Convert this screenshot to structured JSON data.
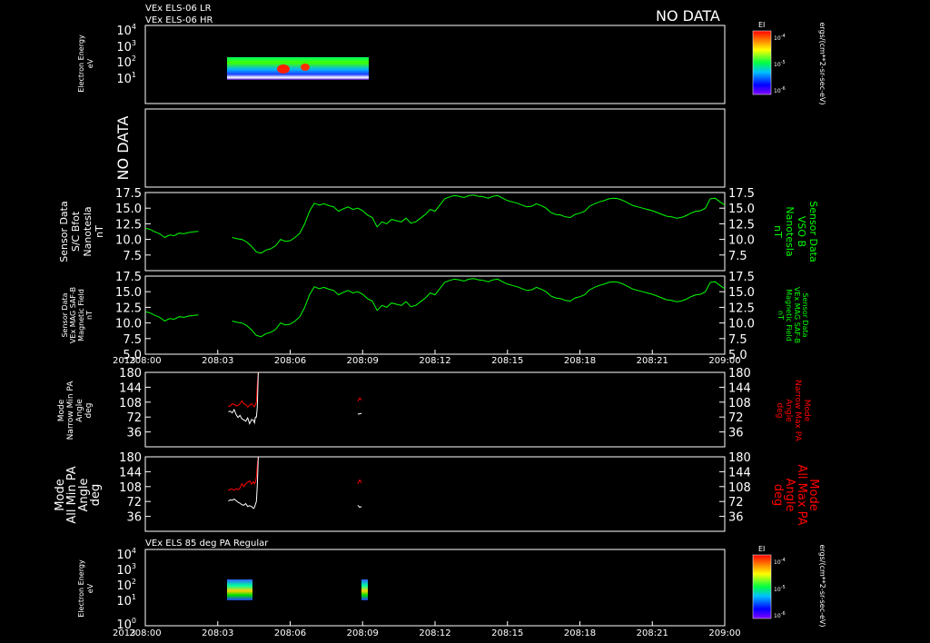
{
  "header": {
    "line1": "VEx ELS-06 LR",
    "line2": "VEx ELS-06 HR",
    "no_data": "NO DATA"
  },
  "colors": {
    "background": "#000000",
    "frame": "#ffffff",
    "mag": "#00ff00",
    "max_pa": "#ff0000",
    "min_pa": "#ffffff"
  },
  "chart_data": [
    {
      "type": "heatmap",
      "title": "",
      "ylabel": [
        "Electron Energy",
        "eV"
      ],
      "y_scale": "log",
      "ylim": [
        1,
        30000
      ],
      "y_ticks": [
        "10^4",
        "10^3",
        "10^2",
        "10^1"
      ],
      "colorbar": {
        "label": "EI",
        "units": "ergs/(cm**2-sr-sec-eV)",
        "ticks": [
          "10^-4",
          "10^-5",
          "10^-6"
        ]
      },
      "xlim": [
        "208:00",
        "209:00"
      ],
      "coverage": [
        {
          "start_min": 3.5,
          "end_min": 9.2,
          "energy_range_eV": [
            5,
            200
          ]
        }
      ]
    },
    {
      "type": "line",
      "label": "NO DATA",
      "series": []
    },
    {
      "type": "line",
      "ylabel_left": [
        "Sensor Data",
        "S/C Bfot",
        "Nanotesla",
        "nT"
      ],
      "ylabel_right": [
        "Sensor Data",
        "VSO B",
        "Nanotesla",
        "nT"
      ],
      "ylim": [
        5,
        17.5
      ],
      "y_ticks": [
        "17.5",
        "15.0",
        "12.5",
        "10.0",
        "7.5"
      ],
      "x": [
        0,
        0.5,
        1,
        1.5,
        2,
        2.5,
        3,
        3.5,
        4,
        4.5,
        5,
        5.5,
        9,
        9.5,
        10,
        10.5,
        11,
        11.5,
        12,
        12.5,
        13,
        13.5,
        14,
        14.5,
        15,
        15.5,
        16,
        16.5,
        17,
        17.5,
        18,
        18.5,
        19,
        19.5,
        20,
        20.5,
        21,
        21.5,
        22,
        22.5,
        23,
        23.5,
        24,
        24.5,
        25,
        25.5,
        26,
        26.5,
        27,
        27.5,
        28,
        28.5,
        29,
        29.5,
        30,
        30.5,
        31,
        31.5,
        32,
        32.5,
        33,
        33.5,
        34,
        34.5,
        35,
        35.5,
        36,
        36.5,
        37,
        37.5,
        38,
        38.5,
        39,
        39.5,
        40,
        40.5,
        41,
        41.5,
        42,
        42.5,
        43,
        43.5,
        44,
        44.5,
        45,
        45.5,
        46,
        46.5,
        47,
        47.5,
        48,
        48.5,
        49,
        49.5,
        50,
        50.5,
        51,
        51.5,
        52,
        52.5,
        53,
        53.5,
        54,
        54.5,
        55,
        55.5,
        56,
        56.5,
        57,
        57.5,
        58,
        58.5,
        59,
        59.5,
        60
      ],
      "y": [
        11.8,
        11.6,
        11.2,
        10.9,
        10.3,
        10.7,
        10.6,
        11.0,
        10.9,
        11.1,
        11.2,
        11.3,
        10.3,
        10.1,
        10.0,
        9.6,
        8.9,
        8.0,
        7.8,
        8.3,
        8.5,
        9.0,
        10.0,
        9.7,
        9.8,
        10.3,
        11.0,
        12.5,
        14.5,
        15.8,
        15.5,
        15.7,
        15.4,
        15.2,
        14.5,
        14.9,
        15.2,
        14.8,
        15.0,
        14.6,
        13.9,
        13.5,
        12.0,
        12.8,
        12.5,
        13.2,
        13.0,
        12.8,
        13.4,
        12.6,
        12.8,
        13.4,
        14.0,
        14.8,
        14.5,
        15.5,
        16.5,
        16.8,
        17.0,
        16.9,
        16.7,
        17.0,
        17.1,
        16.9,
        16.8,
        16.6,
        16.9,
        17.0,
        16.6,
        16.2,
        16.0,
        15.8,
        15.5,
        15.2,
        15.3,
        15.7,
        15.4,
        15.0,
        14.3,
        14.0,
        13.9,
        13.6,
        13.5,
        14.0,
        14.2,
        14.5,
        15.3,
        15.7,
        16.0,
        16.2,
        16.5,
        16.6,
        16.5,
        16.2,
        15.8,
        15.4,
        15.2,
        15.0,
        14.8,
        14.6,
        14.3,
        14.0,
        13.7,
        13.6,
        13.4,
        13.5,
        13.8,
        14.2,
        14.5,
        14.6,
        15.0,
        16.5,
        16.6,
        16.0,
        15.5,
        16.0,
        16.5
      ],
      "gap_after_index": [
        11
      ]
    },
    {
      "type": "line",
      "ylabel_left": [
        "Sensor Data",
        "VEx MAG SAF-B",
        "Magnetic Field",
        "nT"
      ],
      "ylabel_right": [
        "Sensor Data",
        "VEx MAG SAF-B",
        "Magnetic Field",
        "nT"
      ],
      "ylim": [
        5,
        17.5
      ],
      "y_ticks": [
        "17.5",
        "15.0",
        "12.5",
        "10.0",
        "7.5",
        "5.0"
      ],
      "x_ticks": [
        "2013",
        "208:00",
        "208:03",
        "208:06",
        "208:09",
        "208:12",
        "208:15",
        "208:18",
        "208:21",
        "209:00"
      ],
      "x": [
        0,
        0.5,
        1,
        1.5,
        2,
        2.5,
        3,
        3.5,
        4,
        4.5,
        5,
        5.5,
        9,
        9.5,
        10,
        10.5,
        11,
        11.5,
        12,
        12.5,
        13,
        13.5,
        14,
        14.5,
        15,
        15.5,
        16,
        16.5,
        17,
        17.5,
        18,
        18.5,
        19,
        19.5,
        20,
        20.5,
        21,
        21.5,
        22,
        22.5,
        23,
        23.5,
        24,
        24.5,
        25,
        25.5,
        26,
        26.5,
        27,
        27.5,
        28,
        28.5,
        29,
        29.5,
        30,
        30.5,
        31,
        31.5,
        32,
        32.5,
        33,
        33.5,
        34,
        34.5,
        35,
        35.5,
        36,
        36.5,
        37,
        37.5,
        38,
        38.5,
        39,
        39.5,
        40,
        40.5,
        41,
        41.5,
        42,
        42.5,
        43,
        43.5,
        44,
        44.5,
        45,
        45.5,
        46,
        46.5,
        47,
        47.5,
        48,
        48.5,
        49,
        49.5,
        50,
        50.5,
        51,
        51.5,
        52,
        52.5,
        53,
        53.5,
        54,
        54.5,
        55,
        55.5,
        56,
        56.5,
        57,
        57.5,
        58,
        58.5,
        59,
        59.5,
        60
      ],
      "y": [
        11.8,
        11.6,
        11.2,
        10.9,
        10.3,
        10.7,
        10.6,
        11.0,
        10.9,
        11.1,
        11.2,
        11.3,
        10.3,
        10.1,
        10.0,
        9.6,
        8.9,
        8.0,
        7.8,
        8.3,
        8.5,
        9.0,
        10.0,
        9.7,
        9.8,
        10.3,
        11.0,
        12.5,
        14.5,
        15.8,
        15.5,
        15.7,
        15.4,
        15.2,
        14.5,
        14.9,
        15.2,
        14.8,
        15.0,
        14.6,
        13.9,
        13.5,
        12.0,
        12.8,
        12.5,
        13.2,
        13.0,
        12.8,
        13.4,
        12.6,
        12.8,
        13.4,
        14.0,
        14.8,
        14.5,
        15.5,
        16.5,
        16.8,
        17.0,
        16.9,
        16.7,
        17.0,
        17.1,
        16.9,
        16.8,
        16.6,
        16.9,
        17.0,
        16.6,
        16.2,
        16.0,
        15.8,
        15.5,
        15.2,
        15.3,
        15.7,
        15.4,
        15.0,
        14.3,
        14.0,
        13.9,
        13.6,
        13.5,
        14.0,
        14.2,
        14.5,
        15.3,
        15.7,
        16.0,
        16.2,
        16.5,
        16.6,
        16.5,
        16.2,
        15.8,
        15.4,
        15.2,
        15.0,
        14.8,
        14.6,
        14.3,
        14.0,
        13.7,
        13.6,
        13.4,
        13.5,
        13.8,
        14.2,
        14.5,
        14.6,
        15.0,
        16.5,
        16.6,
        16.0,
        15.5,
        16.0,
        16.5
      ],
      "gap_after_index": [
        11
      ]
    },
    {
      "type": "line",
      "ylabel_left": [
        "Mode",
        "Narrow Min PA",
        "Angle",
        "deg"
      ],
      "ylabel_right": [
        "Mode",
        "Narrow Max PA",
        "Angle",
        "deg"
      ],
      "ylim": [
        0,
        180
      ],
      "y_ticks": [
        "180",
        "144",
        "108",
        "72",
        "36"
      ],
      "series": [
        {
          "name": "Max PA",
          "x": [
            8.6,
            8.8,
            9.0,
            9.2,
            9.4,
            9.6,
            9.8,
            10.0,
            10.2,
            10.4,
            10.6,
            10.8,
            11.0,
            11.2,
            11.3,
            11.4,
            11.5,
            11.6,
            11.7,
            22.0,
            22.2,
            22.4
          ],
          "y": [
            97,
            99,
            104,
            103,
            99,
            100,
            104,
            111,
            104,
            102,
            96,
            100,
            104,
            99,
            97,
            102,
            108,
            150,
            180,
            110,
            118,
            113
          ]
        },
        {
          "name": "Min PA",
          "x": [
            8.6,
            8.8,
            9.0,
            9.2,
            9.4,
            9.6,
            9.8,
            10.0,
            10.2,
            10.4,
            10.6,
            10.8,
            11.0,
            11.2,
            11.3,
            11.4,
            11.5,
            11.6,
            11.7,
            22.0,
            22.2,
            22.4
          ],
          "y": [
            85,
            86,
            82,
            90,
            78,
            71,
            76,
            68,
            65,
            62,
            70,
            56,
            66,
            64,
            58,
            72,
            72,
            95,
            180,
            79,
            80,
            81
          ]
        }
      ]
    },
    {
      "type": "line",
      "ylabel_left": [
        "Mode",
        "All Min PA",
        "Angle",
        "deg"
      ],
      "ylabel_right": [
        "Mode",
        "All Max PA",
        "Angle",
        "deg"
      ],
      "ylim": [
        0,
        180
      ],
      "y_ticks": [
        "180",
        "144",
        "108",
        "72",
        "36"
      ],
      "series": [
        {
          "name": "Max PA",
          "x": [
            8.6,
            8.8,
            9.0,
            9.2,
            9.4,
            9.6,
            9.8,
            10.0,
            10.2,
            10.4,
            10.6,
            10.8,
            11.0,
            11.2,
            11.3,
            11.4,
            11.5,
            11.6,
            11.7,
            22.0,
            22.2,
            22.4
          ],
          "y": [
            98,
            102,
            102,
            99,
            103,
            101,
            104,
            115,
            108,
            115,
            118,
            122,
            114,
            120,
            115,
            118,
            130,
            160,
            180,
            115,
            124,
            117
          ]
        },
        {
          "name": "Min PA",
          "x": [
            8.6,
            8.8,
            9.0,
            9.2,
            9.4,
            9.6,
            9.8,
            10.0,
            10.2,
            10.4,
            10.6,
            10.8,
            11.0,
            11.2,
            11.3,
            11.4,
            11.5,
            11.6,
            11.7,
            22.0,
            22.2,
            22.4
          ],
          "y": [
            73,
            76,
            75,
            78,
            74,
            70,
            68,
            64,
            63,
            67,
            60,
            62,
            60,
            55,
            58,
            65,
            72,
            110,
            180,
            63,
            58,
            60
          ]
        }
      ]
    },
    {
      "type": "heatmap",
      "title": "VEx ELS 85 deg PA Regular",
      "ylabel": [
        "Electron Energy",
        "eV"
      ],
      "y_scale": "log",
      "ylim": [
        1,
        30000
      ],
      "y_ticks": [
        "10^4",
        "10^3",
        "10^2",
        "10^1",
        "10^0"
      ],
      "x_ticks": [
        "2013",
        "208:00",
        "208:03",
        "208:06",
        "208:09",
        "208:12",
        "208:15",
        "208:18",
        "208:21",
        "209:00"
      ],
      "colorbar": {
        "label": "EI",
        "units": "ergs/(cm**2-sr-sec-eV)",
        "ticks": [
          "10^-4",
          "10^-5",
          "10^-6"
        ]
      },
      "coverage": [
        {
          "start_min": 3.5,
          "end_min": 4.8,
          "energy_range_eV": [
            7,
            200
          ]
        },
        {
          "start_min": 8.9,
          "end_min": 9.2,
          "energy_range_eV": [
            7,
            200
          ]
        }
      ]
    }
  ]
}
